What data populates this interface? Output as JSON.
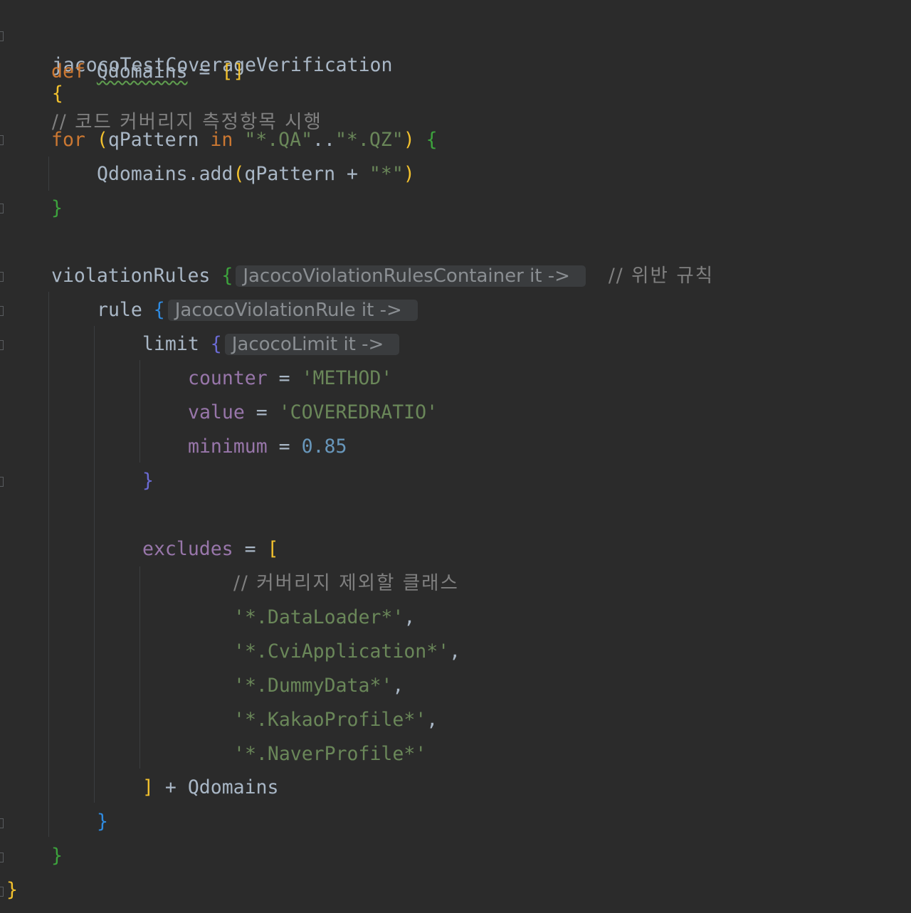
{
  "code": {
    "line1": {
      "task": "jacocoTestCoverageVerification",
      "brace": "{",
      "comment": "// 코드 커버리지 측정항목 시행"
    },
    "line2": {
      "kw_def": "def",
      "var": "Qdomains",
      "op": "=",
      "value": "[]"
    },
    "line4": {
      "kw_for": "for",
      "paren_open": "(",
      "var": "qPattern",
      "kw_in": "in",
      "range_start": "\"*.QA\"",
      "range_op": "..",
      "range_end": "\"*.QZ\"",
      "paren_close": ")",
      "brace": "{"
    },
    "line5": {
      "text": "Qdomains.add",
      "paren_open": "(",
      "args": "qPattern + ",
      "arg_str": "\"*\"",
      "paren_close": ")"
    },
    "line6": {
      "brace": "}"
    },
    "line8": {
      "name": "violationRules",
      "brace": "{",
      "hint": "JacocoViolationRulesContainer it ->",
      "comment": "// 위반 규칙"
    },
    "line9": {
      "name": "rule",
      "brace": "{",
      "hint": "JacocoViolationRule it ->"
    },
    "line10": {
      "name": "limit",
      "brace": "{",
      "hint": "JacocoLimit it ->"
    },
    "line11": {
      "prop": "counter",
      "op": "=",
      "value": "'METHOD'"
    },
    "line12": {
      "prop": "value",
      "op": "=",
      "value": "'COVEREDRATIO'"
    },
    "line13": {
      "prop": "minimum",
      "op": "=",
      "value": "0.85"
    },
    "line14": {
      "brace": "}"
    },
    "line16": {
      "prop": "excludes",
      "op": "=",
      "bracket": "["
    },
    "line17": {
      "comment": "// 커버리지 제외할 클래스"
    },
    "excludes": [
      {
        "value": "'*.DataLoader*'",
        "sep": ","
      },
      {
        "value": "'*.CviApplication*'",
        "sep": ","
      },
      {
        "value": "'*.DummyData*'",
        "sep": ","
      },
      {
        "value": "'*.KakaoProfile*'",
        "sep": ","
      },
      {
        "value": "'*.NaverProfile*'",
        "sep": ""
      }
    ],
    "line23": {
      "bracket": "]",
      "rest": " + Qdomains"
    },
    "line24": {
      "brace": "}"
    },
    "line25": {
      "brace": "}"
    },
    "line26": {
      "brace": "}"
    }
  },
  "colors": {
    "background": "#2b2b2b",
    "keyword": "#cc7832",
    "string": "#6a8759",
    "number": "#6897bb",
    "property": "#9876aa",
    "comment": "#808080",
    "default_text": "#a9b7c6"
  }
}
